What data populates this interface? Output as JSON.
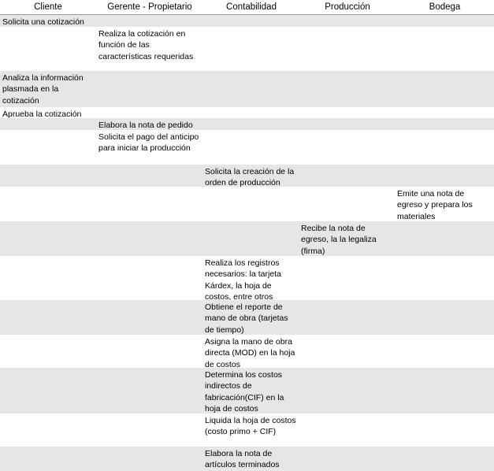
{
  "columns": [
    "Cliente",
    "Gerente - Propietario",
    "Contabilidad",
    "Producción",
    "Bodega"
  ],
  "rows": [
    {
      "col": 0,
      "text": "Solicita una cotización"
    },
    {
      "col": 1,
      "text": "Realiza la cotización en función de las características requeridas"
    },
    {
      "col": 0,
      "text": "Analiza la información plasmada en la cotización"
    },
    {
      "col": 0,
      "text": "Aprueba la cotización"
    },
    {
      "col": 1,
      "text": "Elabora la nota de pedido"
    },
    {
      "col": 1,
      "text": "Solicita el pago del anticipo para iniciar la producción"
    },
    {
      "col": 2,
      "text": "Solicita la creación de la orden de producción"
    },
    {
      "col": 4,
      "text": "Emite una nota de egreso y prepara los materiales"
    },
    {
      "col": 3,
      "text": "Recibe la nota de egreso, la la legaliza (firma)"
    },
    {
      "col": 2,
      "text": "Realiza los registros necesarios: la tarjeta Kárdex, la hoja de costos, entre otros"
    },
    {
      "col": 2,
      "text": "Obtiene el reporte de mano de obra (tarjetas de tiempo)"
    },
    {
      "col": 2,
      "text": "Asigna la mano de obra directa (MOD) en la hoja de costos"
    },
    {
      "col": 2,
      "text": "Determina los costos indirectos de fabricación(CIF) en la hoja de costos"
    },
    {
      "col": 2,
      "text": "Liquida la hoja de costos (costo primo + CIF)"
    },
    {
      "col": 2,
      "text": "Elabora la nota de artículos terminados"
    }
  ]
}
